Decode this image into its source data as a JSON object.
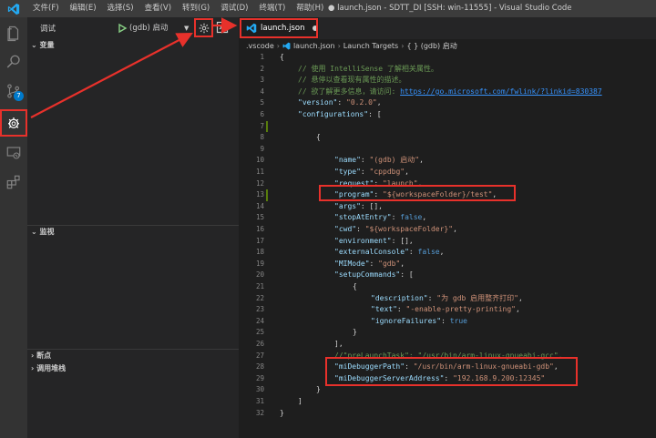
{
  "titlebar": {
    "menus": [
      "文件(F)",
      "编辑(E)",
      "选择(S)",
      "查看(V)",
      "转到(G)",
      "调试(D)",
      "终端(T)",
      "帮助(H)"
    ],
    "window_title": "● launch.json - SDTT_DI [SSH: win-11555] - Visual Studio Code"
  },
  "activitybar": {
    "scm_badge": "7"
  },
  "debug": {
    "title": "调试",
    "config": "(gdb) 启动",
    "sections": {
      "variables": "变量",
      "watch": "监视",
      "breakpoints": "断点",
      "callstack": "调用堆栈"
    }
  },
  "editor": {
    "tab_label": "launch.json",
    "breadcrumb": [
      ".vscode",
      "launch.json",
      "Launch Targets",
      "{ } (gdb) 启动"
    ]
  },
  "colors": {
    "accent": "#007acc",
    "highlight_red": "#e8312b",
    "activitybar": "#333333",
    "sidebar": "#252526",
    "editor": "#1e1e1e"
  },
  "code_lines": [
    {
      "n": "1",
      "indent": 0,
      "parts": [
        {
          "t": "{",
          "c": "p"
        }
      ]
    },
    {
      "n": "2",
      "indent": 1,
      "parts": [
        {
          "t": "// 使用 IntelliSense 了解相关属性。",
          "c": "c"
        }
      ]
    },
    {
      "n": "3",
      "indent": 1,
      "parts": [
        {
          "t": "// 悬停以查看现有属性的描述。",
          "c": "c"
        }
      ]
    },
    {
      "n": "4",
      "indent": 1,
      "parts": [
        {
          "t": "// 欲了解更多信息，请访问: ",
          "c": "c"
        },
        {
          "t": "https://go.microsoft.com/fwlink/?linkid=830387",
          "c": "u"
        }
      ]
    },
    {
      "n": "5",
      "indent": 1,
      "parts": [
        {
          "t": "\"version\"",
          "c": "k"
        },
        {
          "t": ": ",
          "c": "p"
        },
        {
          "t": "\"0.2.0\"",
          "c": "s"
        },
        {
          "t": ",",
          "c": "p"
        }
      ]
    },
    {
      "n": "6",
      "indent": 1,
      "parts": [
        {
          "t": "\"configurations\"",
          "c": "k"
        },
        {
          "t": ": [",
          "c": "p"
        }
      ]
    },
    {
      "n": "7",
      "indent": 0,
      "parts": []
    },
    {
      "n": "8",
      "indent": 2,
      "parts": [
        {
          "t": "{",
          "c": "p"
        }
      ]
    },
    {
      "n": "9",
      "indent": 0,
      "parts": []
    },
    {
      "n": "10",
      "indent": 3,
      "parts": [
        {
          "t": "\"name\"",
          "c": "k"
        },
        {
          "t": ": ",
          "c": "p"
        },
        {
          "t": "\"(gdb) 启动\"",
          "c": "s"
        },
        {
          "t": ",",
          "c": "p"
        }
      ]
    },
    {
      "n": "11",
      "indent": 3,
      "parts": [
        {
          "t": "\"type\"",
          "c": "k"
        },
        {
          "t": ": ",
          "c": "p"
        },
        {
          "t": "\"cppdbg\"",
          "c": "s"
        },
        {
          "t": ",",
          "c": "p"
        }
      ]
    },
    {
      "n": "12",
      "indent": 3,
      "parts": [
        {
          "t": "\"request\"",
          "c": "k"
        },
        {
          "t": ": ",
          "c": "p"
        },
        {
          "t": "\"launch\"",
          "c": "s"
        },
        {
          "t": ",",
          "c": "p"
        }
      ]
    },
    {
      "n": "13",
      "indent": 3,
      "parts": [
        {
          "t": "\"program\"",
          "c": "k"
        },
        {
          "t": ": ",
          "c": "p"
        },
        {
          "t": "\"${workspaceFolder}/test\"",
          "c": "s"
        },
        {
          "t": ",",
          "c": "p"
        }
      ]
    },
    {
      "n": "14",
      "indent": 3,
      "parts": [
        {
          "t": "\"args\"",
          "c": "k"
        },
        {
          "t": ": [],",
          "c": "p"
        }
      ]
    },
    {
      "n": "15",
      "indent": 3,
      "parts": [
        {
          "t": "\"stopAtEntry\"",
          "c": "k"
        },
        {
          "t": ": ",
          "c": "p"
        },
        {
          "t": "false",
          "c": "b"
        },
        {
          "t": ",",
          "c": "p"
        }
      ]
    },
    {
      "n": "16",
      "indent": 3,
      "parts": [
        {
          "t": "\"cwd\"",
          "c": "k"
        },
        {
          "t": ": ",
          "c": "p"
        },
        {
          "t": "\"${workspaceFolder}\"",
          "c": "s"
        },
        {
          "t": ",",
          "c": "p"
        }
      ]
    },
    {
      "n": "17",
      "indent": 3,
      "parts": [
        {
          "t": "\"environment\"",
          "c": "k"
        },
        {
          "t": ": [],",
          "c": "p"
        }
      ]
    },
    {
      "n": "18",
      "indent": 3,
      "parts": [
        {
          "t": "\"externalConsole\"",
          "c": "k"
        },
        {
          "t": ": ",
          "c": "p"
        },
        {
          "t": "false",
          "c": "b"
        },
        {
          "t": ",",
          "c": "p"
        }
      ]
    },
    {
      "n": "19",
      "indent": 3,
      "parts": [
        {
          "t": "\"MIMode\"",
          "c": "k"
        },
        {
          "t": ": ",
          "c": "p"
        },
        {
          "t": "\"gdb\"",
          "c": "s"
        },
        {
          "t": ",",
          "c": "p"
        }
      ]
    },
    {
      "n": "20",
      "indent": 3,
      "parts": [
        {
          "t": "\"setupCommands\"",
          "c": "k"
        },
        {
          "t": ": [",
          "c": "p"
        }
      ]
    },
    {
      "n": "21",
      "indent": 4,
      "parts": [
        {
          "t": "{",
          "c": "p"
        }
      ]
    },
    {
      "n": "22",
      "indent": 5,
      "parts": [
        {
          "t": "\"description\"",
          "c": "k"
        },
        {
          "t": ": ",
          "c": "p"
        },
        {
          "t": "\"为 gdb 启用整齐打印\"",
          "c": "s"
        },
        {
          "t": ",",
          "c": "p"
        }
      ]
    },
    {
      "n": "23",
      "indent": 5,
      "parts": [
        {
          "t": "\"text\"",
          "c": "k"
        },
        {
          "t": ": ",
          "c": "p"
        },
        {
          "t": "\"-enable-pretty-printing\"",
          "c": "s"
        },
        {
          "t": ",",
          "c": "p"
        }
      ]
    },
    {
      "n": "24",
      "indent": 5,
      "parts": [
        {
          "t": "\"ignoreFailures\"",
          "c": "k"
        },
        {
          "t": ": ",
          "c": "p"
        },
        {
          "t": "true",
          "c": "b"
        }
      ]
    },
    {
      "n": "25",
      "indent": 4,
      "parts": [
        {
          "t": "}",
          "c": "p"
        }
      ]
    },
    {
      "n": "26",
      "indent": 3,
      "parts": [
        {
          "t": "],",
          "c": "p"
        }
      ]
    },
    {
      "n": "27",
      "indent": 3,
      "parts": [
        {
          "t": "//\"preLaunchTask\": \"/usr/bin/arm-linux-gnueabi-gcc\",",
          "c": "c"
        }
      ]
    },
    {
      "n": "28",
      "indent": 3,
      "parts": [
        {
          "t": "\"miDebuggerPath\"",
          "c": "k"
        },
        {
          "t": ": ",
          "c": "p"
        },
        {
          "t": "\"/usr/bin/arm-linux-gnueabi-gdb\"",
          "c": "s"
        },
        {
          "t": ",",
          "c": "p"
        }
      ]
    },
    {
      "n": "29",
      "indent": 3,
      "parts": [
        {
          "t": "\"miDebuggerServerAddress\"",
          "c": "k"
        },
        {
          "t": ": ",
          "c": "p"
        },
        {
          "t": "\"192.168.9.200:12345\"",
          "c": "s"
        }
      ]
    },
    {
      "n": "30",
      "indent": 2,
      "parts": [
        {
          "t": "}",
          "c": "p"
        }
      ]
    },
    {
      "n": "31",
      "indent": 1,
      "parts": [
        {
          "t": "]",
          "c": "p"
        }
      ]
    },
    {
      "n": "32",
      "indent": 0,
      "parts": [
        {
          "t": "}",
          "c": "p"
        }
      ]
    }
  ]
}
